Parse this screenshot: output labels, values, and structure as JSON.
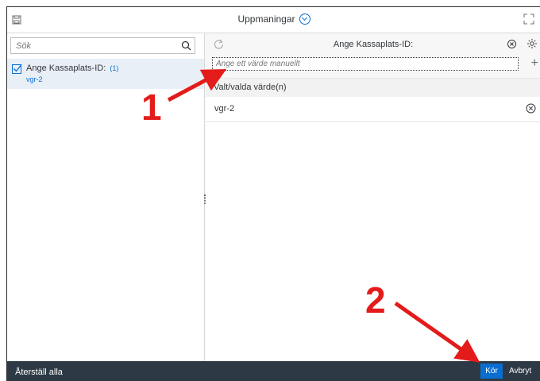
{
  "header": {
    "title": "Uppmaningar"
  },
  "left": {
    "search_placeholder": "Sök",
    "item": {
      "label": "Ange Kassaplats-ID:",
      "count": "(1)",
      "value": "vgr-2"
    }
  },
  "right": {
    "title": "Ange Kassaplats-ID:",
    "manual_placeholder": "Ange ett värde manuellt",
    "selected_header": "Valt/valda värde(n)",
    "selected_values": [
      "vgr-2"
    ]
  },
  "footer": {
    "reset_label": "Återställ alla",
    "run_label": "Kör",
    "cancel_label": "Avbryt"
  },
  "annotations": {
    "first": "1",
    "second": "2"
  },
  "colors": {
    "accent": "#0a6ed1",
    "footer_bg": "#2d3a45",
    "annotation": "#e31b1b"
  },
  "icons": [
    "save-icon",
    "chevron-down-icon",
    "fullscreen-icon",
    "search-icon",
    "checkbox-icon",
    "refresh-icon",
    "clear-selection-icon",
    "settings-icon",
    "add-icon",
    "remove-icon"
  ]
}
